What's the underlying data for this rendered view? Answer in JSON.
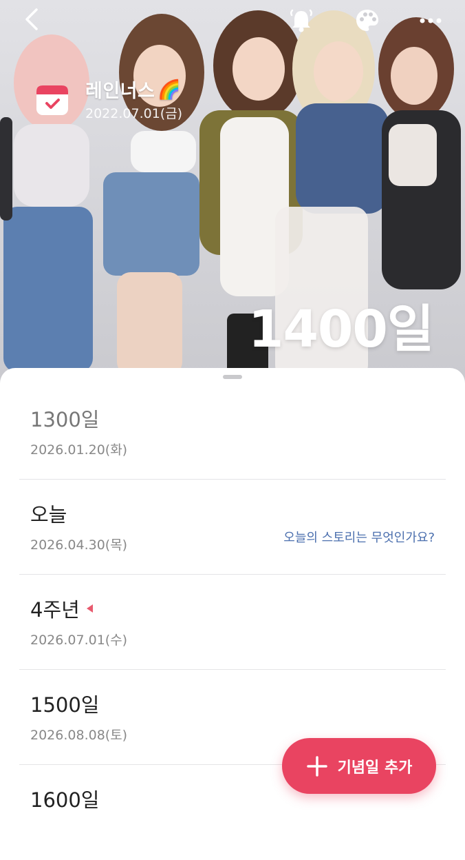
{
  "header": {
    "back_icon": "chevron-left-icon",
    "notification_icon": "bell-icon",
    "theme_icon": "palette-icon",
    "more_icon": "more-horizontal-icon"
  },
  "event": {
    "icon": "calendar-check-icon",
    "title": "레인너스",
    "emoji": "🌈",
    "start_date": "2022.07.01(금)",
    "day_count": "1400일"
  },
  "milestones": [
    {
      "label": "1300일",
      "date": "2026.01.20(화)",
      "state": "past"
    },
    {
      "label": "오늘",
      "date": "2026.04.30(목)",
      "story_prompt": "오늘의 스토리는 무엇인가요?"
    },
    {
      "label": "4주년",
      "date": "2026.07.01(수)",
      "marker": "upcoming-marker"
    },
    {
      "label": "1500일",
      "date": "2026.08.08(토)"
    },
    {
      "label": "1600일",
      "date": ""
    }
  ],
  "fab": {
    "icon": "plus-icon",
    "label": "기념일 추가"
  },
  "colors": {
    "accent": "#e94461",
    "story_link": "#4b6fae",
    "calendar_icon": "#e94461"
  }
}
